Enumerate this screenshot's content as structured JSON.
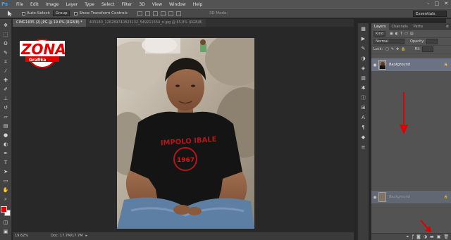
{
  "menubar": {
    "logo": "Ps",
    "items": [
      "File",
      "Edit",
      "Image",
      "Layer",
      "Type",
      "Select",
      "Filter",
      "3D",
      "View",
      "Window",
      "Help"
    ],
    "window_controls": [
      "–",
      "□",
      "✕"
    ]
  },
  "options": {
    "auto_select_label": "Auto-Select:",
    "auto_select_value": "Group",
    "transform_label": "Show Transform Controls",
    "mode_3d_label": "3D Mode:",
    "workspace": "Essentials"
  },
  "tabs": [
    {
      "label": "CIMG1635 (2).JPG @ 19.6% (RGB/8) *",
      "active": true
    },
    {
      "label": "403180_126289740823132_549211554_n.jpg @ 65.8% (RGB/8)",
      "active": false
    }
  ],
  "status": {
    "zoom": "19.62%",
    "doc_info": "Doc: 17.7M/17.7M"
  },
  "panel": {
    "tabs": [
      "Layers",
      "Channels",
      "Paths"
    ],
    "blend_mode": "Normal",
    "opacity_label": "Opacity:",
    "lock_label": "Lock:",
    "fill_label": "Fill:",
    "kind_label": "Kind",
    "layer_name": "Background",
    "ghost_layer_name": "Background"
  },
  "logo": {
    "title": "ZONA",
    "subtitle": "Grafika"
  },
  "colors": {
    "foreground": "#e00000",
    "background": "#ffffff",
    "annotation_arrow": "#e00000"
  },
  "icons": {
    "tools": [
      "move-tool-icon",
      "marquee-tool-icon",
      "lasso-tool-icon",
      "quick-select-tool-icon",
      "crop-tool-icon",
      "eyedropper-tool-icon",
      "healing-brush-icon",
      "brush-tool-icon",
      "clone-stamp-icon",
      "history-brush-icon",
      "eraser-tool-icon",
      "gradient-tool-icon",
      "blur-tool-icon",
      "dodge-tool-icon",
      "pen-tool-icon",
      "type-tool-icon",
      "path-select-icon",
      "shape-tool-icon",
      "hand-tool-icon",
      "zoom-tool-icon"
    ],
    "panel_bottom": [
      "link-icon",
      "fx-icon",
      "mask-icon",
      "adjustment-icon",
      "folder-icon",
      "new-layer-icon",
      "trash-icon"
    ]
  }
}
